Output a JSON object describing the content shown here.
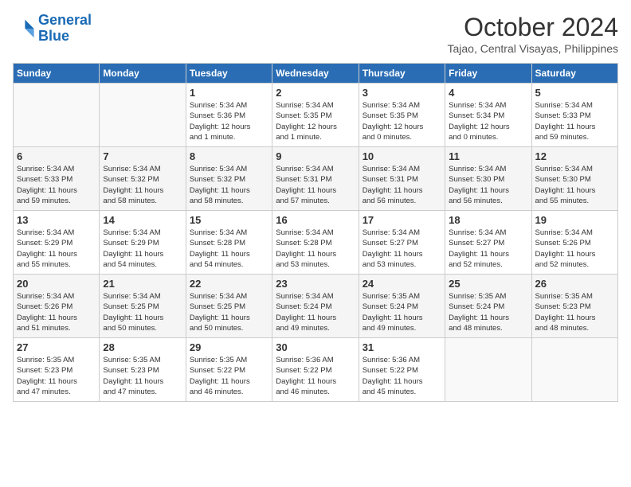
{
  "header": {
    "logo_line1": "General",
    "logo_line2": "Blue",
    "month_title": "October 2024",
    "subtitle": "Tajao, Central Visayas, Philippines"
  },
  "weekdays": [
    "Sunday",
    "Monday",
    "Tuesday",
    "Wednesday",
    "Thursday",
    "Friday",
    "Saturday"
  ],
  "weeks": [
    [
      {
        "day": "",
        "info": ""
      },
      {
        "day": "",
        "info": ""
      },
      {
        "day": "1",
        "info": "Sunrise: 5:34 AM\nSunset: 5:36 PM\nDaylight: 12 hours\nand 1 minute."
      },
      {
        "day": "2",
        "info": "Sunrise: 5:34 AM\nSunset: 5:35 PM\nDaylight: 12 hours\nand 1 minute."
      },
      {
        "day": "3",
        "info": "Sunrise: 5:34 AM\nSunset: 5:35 PM\nDaylight: 12 hours\nand 0 minutes."
      },
      {
        "day": "4",
        "info": "Sunrise: 5:34 AM\nSunset: 5:34 PM\nDaylight: 12 hours\nand 0 minutes."
      },
      {
        "day": "5",
        "info": "Sunrise: 5:34 AM\nSunset: 5:33 PM\nDaylight: 11 hours\nand 59 minutes."
      }
    ],
    [
      {
        "day": "6",
        "info": "Sunrise: 5:34 AM\nSunset: 5:33 PM\nDaylight: 11 hours\nand 59 minutes."
      },
      {
        "day": "7",
        "info": "Sunrise: 5:34 AM\nSunset: 5:32 PM\nDaylight: 11 hours\nand 58 minutes."
      },
      {
        "day": "8",
        "info": "Sunrise: 5:34 AM\nSunset: 5:32 PM\nDaylight: 11 hours\nand 58 minutes."
      },
      {
        "day": "9",
        "info": "Sunrise: 5:34 AM\nSunset: 5:31 PM\nDaylight: 11 hours\nand 57 minutes."
      },
      {
        "day": "10",
        "info": "Sunrise: 5:34 AM\nSunset: 5:31 PM\nDaylight: 11 hours\nand 56 minutes."
      },
      {
        "day": "11",
        "info": "Sunrise: 5:34 AM\nSunset: 5:30 PM\nDaylight: 11 hours\nand 56 minutes."
      },
      {
        "day": "12",
        "info": "Sunrise: 5:34 AM\nSunset: 5:30 PM\nDaylight: 11 hours\nand 55 minutes."
      }
    ],
    [
      {
        "day": "13",
        "info": "Sunrise: 5:34 AM\nSunset: 5:29 PM\nDaylight: 11 hours\nand 55 minutes."
      },
      {
        "day": "14",
        "info": "Sunrise: 5:34 AM\nSunset: 5:29 PM\nDaylight: 11 hours\nand 54 minutes."
      },
      {
        "day": "15",
        "info": "Sunrise: 5:34 AM\nSunset: 5:28 PM\nDaylight: 11 hours\nand 54 minutes."
      },
      {
        "day": "16",
        "info": "Sunrise: 5:34 AM\nSunset: 5:28 PM\nDaylight: 11 hours\nand 53 minutes."
      },
      {
        "day": "17",
        "info": "Sunrise: 5:34 AM\nSunset: 5:27 PM\nDaylight: 11 hours\nand 53 minutes."
      },
      {
        "day": "18",
        "info": "Sunrise: 5:34 AM\nSunset: 5:27 PM\nDaylight: 11 hours\nand 52 minutes."
      },
      {
        "day": "19",
        "info": "Sunrise: 5:34 AM\nSunset: 5:26 PM\nDaylight: 11 hours\nand 52 minutes."
      }
    ],
    [
      {
        "day": "20",
        "info": "Sunrise: 5:34 AM\nSunset: 5:26 PM\nDaylight: 11 hours\nand 51 minutes."
      },
      {
        "day": "21",
        "info": "Sunrise: 5:34 AM\nSunset: 5:25 PM\nDaylight: 11 hours\nand 50 minutes."
      },
      {
        "day": "22",
        "info": "Sunrise: 5:34 AM\nSunset: 5:25 PM\nDaylight: 11 hours\nand 50 minutes."
      },
      {
        "day": "23",
        "info": "Sunrise: 5:34 AM\nSunset: 5:24 PM\nDaylight: 11 hours\nand 49 minutes."
      },
      {
        "day": "24",
        "info": "Sunrise: 5:35 AM\nSunset: 5:24 PM\nDaylight: 11 hours\nand 49 minutes."
      },
      {
        "day": "25",
        "info": "Sunrise: 5:35 AM\nSunset: 5:24 PM\nDaylight: 11 hours\nand 48 minutes."
      },
      {
        "day": "26",
        "info": "Sunrise: 5:35 AM\nSunset: 5:23 PM\nDaylight: 11 hours\nand 48 minutes."
      }
    ],
    [
      {
        "day": "27",
        "info": "Sunrise: 5:35 AM\nSunset: 5:23 PM\nDaylight: 11 hours\nand 47 minutes."
      },
      {
        "day": "28",
        "info": "Sunrise: 5:35 AM\nSunset: 5:23 PM\nDaylight: 11 hours\nand 47 minutes."
      },
      {
        "day": "29",
        "info": "Sunrise: 5:35 AM\nSunset: 5:22 PM\nDaylight: 11 hours\nand 46 minutes."
      },
      {
        "day": "30",
        "info": "Sunrise: 5:36 AM\nSunset: 5:22 PM\nDaylight: 11 hours\nand 46 minutes."
      },
      {
        "day": "31",
        "info": "Sunrise: 5:36 AM\nSunset: 5:22 PM\nDaylight: 11 hours\nand 45 minutes."
      },
      {
        "day": "",
        "info": ""
      },
      {
        "day": "",
        "info": ""
      }
    ]
  ]
}
